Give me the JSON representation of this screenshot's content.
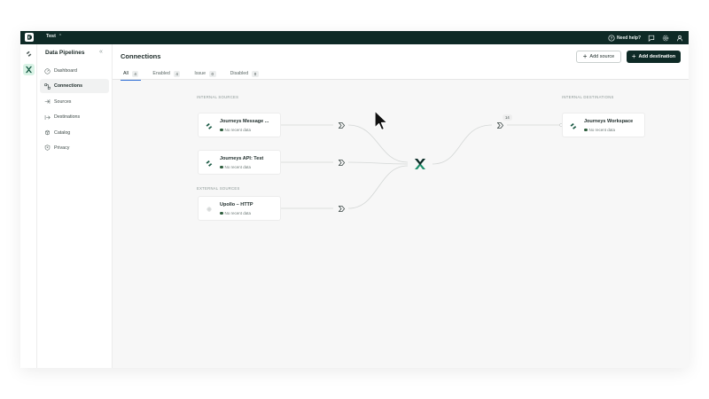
{
  "topbar": {
    "workspace": "Test",
    "help_label": "Need help?",
    "colors": {
      "background": "#0e2a26"
    }
  },
  "sidebar": {
    "title": "Data Pipelines",
    "items": [
      {
        "label": "Dashboard",
        "icon": "gauge-icon",
        "active": false
      },
      {
        "label": "Connections",
        "icon": "connections-icon",
        "active": true
      },
      {
        "label": "Sources",
        "icon": "sources-icon",
        "active": false
      },
      {
        "label": "Destinations",
        "icon": "destinations-icon",
        "active": false
      },
      {
        "label": "Catalog",
        "icon": "catalog-icon",
        "active": false
      },
      {
        "label": "Privacy",
        "icon": "privacy-icon",
        "active": false
      }
    ]
  },
  "header": {
    "title": "Connections",
    "add_source": "Add source",
    "add_destination": "Add destination"
  },
  "tabs": [
    {
      "label": "All",
      "count": "4",
      "active": true
    },
    {
      "label": "Enabled",
      "count": "4",
      "active": false
    },
    {
      "label": "Issue",
      "count": "0",
      "active": false
    },
    {
      "label": "Disabled",
      "count": "0",
      "active": false
    }
  ],
  "canvas": {
    "internal_sources_label": "INTERNAL SOURCES",
    "external_sources_label": "EXTERNAL SOURCES",
    "internal_destinations_label": "INTERNAL DESTINATIONS",
    "sources": [
      {
        "title": "Journeys Message ...",
        "status": "No recent data"
      },
      {
        "title": "Journeys API: Test",
        "status": "No recent data"
      },
      {
        "title": "Upollo – HTTP",
        "status": "No recent data"
      }
    ],
    "destinations": [
      {
        "title": "Journeys Workspace",
        "status": "No recent data",
        "badge": "14"
      }
    ]
  },
  "colors": {
    "accent": "#2f6fd6",
    "brand_green": "#1e8f6b",
    "status_dot": "#2f5e3e"
  }
}
